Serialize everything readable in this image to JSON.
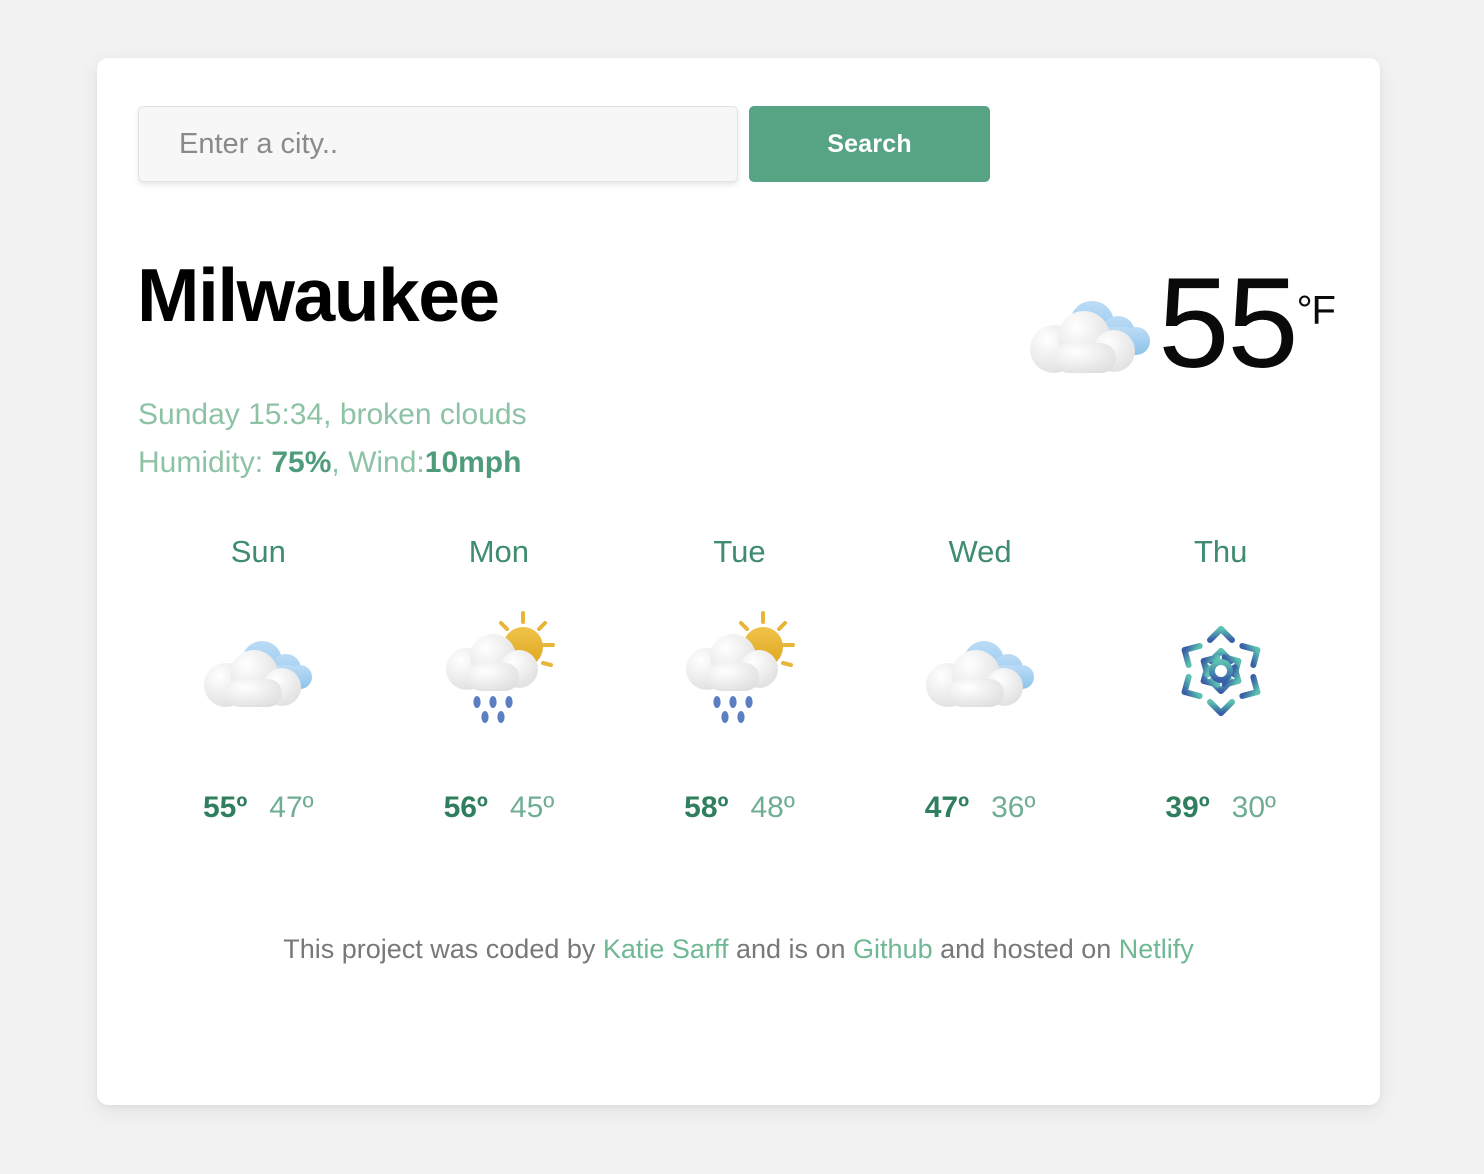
{
  "search": {
    "placeholder": "Enter a city..",
    "value": "",
    "button_label": "Search"
  },
  "current": {
    "city": "Milwaukee",
    "date_time": "Sunday 15:34",
    "description": "broken clouds",
    "conditions_line1": "Sunday 15:34, broken clouds",
    "humidity_label": "Humidity: ",
    "humidity_value": "75%",
    "wind_label": ", Wind:",
    "wind_value": "10mph",
    "temperature": "55",
    "unit": "°F",
    "icon": "broken-clouds-icon"
  },
  "forecast": [
    {
      "day": "Sun",
      "icon": "broken-clouds-icon",
      "max": "55º",
      "min": "47º"
    },
    {
      "day": "Mon",
      "icon": "sun-behind-rain-cloud-icon",
      "max": "56º",
      "min": "45º"
    },
    {
      "day": "Tue",
      "icon": "sun-behind-rain-cloud-icon",
      "max": "58º",
      "min": "48º"
    },
    {
      "day": "Wed",
      "icon": "broken-clouds-icon",
      "max": "47º",
      "min": "36º"
    },
    {
      "day": "Thu",
      "icon": "snowflake-icon",
      "max": "39º",
      "min": "30º"
    }
  ],
  "footer": {
    "text_1": "This project was coded by ",
    "author_link": "Katie Sarff",
    "text_2": " and is on ",
    "github_link": "Github",
    "text_3": " and hosted on ",
    "netlify_link": "Netlify"
  },
  "colors": {
    "accent_green": "#56a484",
    "light_green": "#8ec2a5",
    "strong_green": "#4e9c79",
    "day_green": "#3f8c6e",
    "max_green": "#2f7f5e",
    "min_green": "#6fae92",
    "footer_grey": "#787878",
    "page_bg": "#f2f2f2",
    "card_bg": "#ffffff",
    "cloud_blue": "#9ecdf0",
    "sun_gold": "#e8b53a",
    "rain_blue": "#5b7fc0",
    "snow_teal": "#5cc0b0",
    "snow_blue": "#3a5fa8"
  }
}
